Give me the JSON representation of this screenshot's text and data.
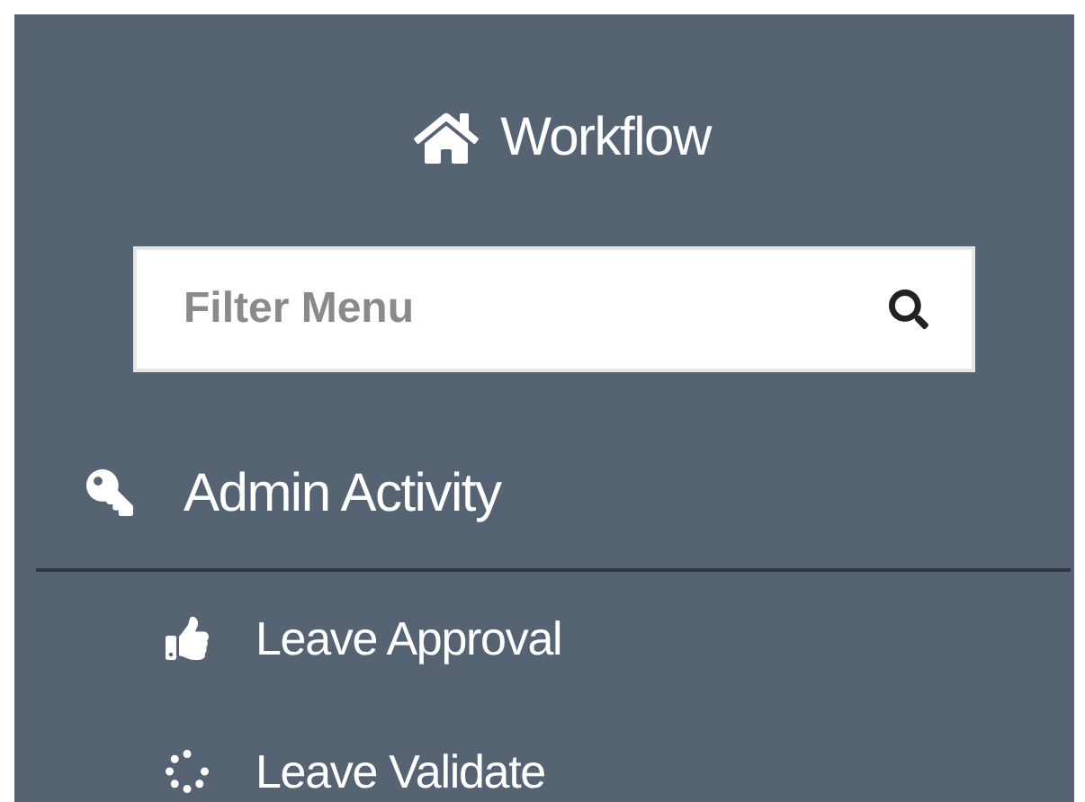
{
  "header": {
    "title": "Workflow"
  },
  "filter": {
    "placeholder": "Filter Menu"
  },
  "section": {
    "label": "Admin Activity"
  },
  "items": [
    {
      "label": "Leave Approval",
      "kind": "approve"
    },
    {
      "label": "Leave Validate",
      "kind": "validate"
    }
  ]
}
